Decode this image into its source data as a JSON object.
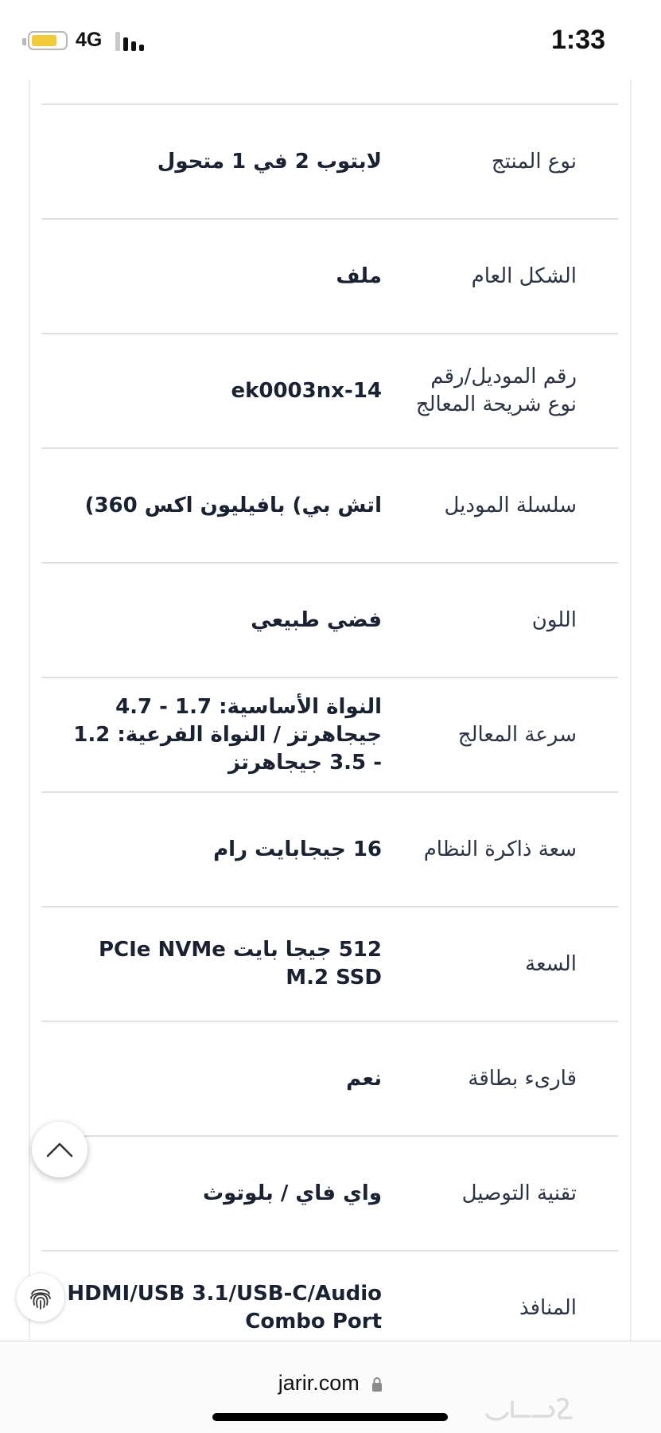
{
  "status_bar": {
    "network": "4G",
    "time": "1:33",
    "battery_level": 0.7,
    "signal_bars": 3,
    "battery_color": "#f2cb3a"
  },
  "specs": [
    {
      "label": "نوع المنتج",
      "value": "لابتوب 2 في 1 متحول"
    },
    {
      "label": "الشكل العام",
      "value": "ملف"
    },
    {
      "label": "رقم الموديل/رقم نوع شريحة المعالج",
      "value": "14-ek0003nx"
    },
    {
      "label": "سلسلة الموديل",
      "value": "اتش بي) بافيليون اكس 360)"
    },
    {
      "label": "اللون",
      "value": "فضي طبيعي"
    },
    {
      "label": "سرعة المعالج",
      "value": "النواة الأساسية: 1.7 - 4.7 جيجاهرتز / النواة الفرعية: 1.2 - 3.5 جيجاهرتز"
    },
    {
      "label": "سعة ذاكرة النظام",
      "value": "16 جيجابايت رام"
    },
    {
      "label": "السعة",
      "value": "512 جيجا بايت PCIe NVMe M.2 SSD"
    },
    {
      "label": "قارىء بطاقة",
      "value": "نعم"
    },
    {
      "label": "تقنية التوصيل",
      "value": "واي فاي / بلوتوث"
    },
    {
      "label": "المنافذ",
      "value": "HDMI/USB 3.1/USB-C/Audio Combo Port"
    }
  ],
  "floating": {
    "scroll_top_icon": "chevron-up-icon",
    "fingerprint_icon": "fingerprint-icon"
  },
  "browser": {
    "url": "jarir.com",
    "lock_icon": "lock-icon",
    "watermark_icon": "haraj-logo"
  }
}
